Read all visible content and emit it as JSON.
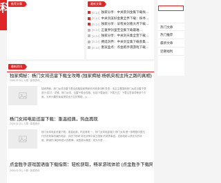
{
  "left_strip": {
    "glyph": "科"
  },
  "recommend": {
    "tag": "推荐文章"
  },
  "hot": {
    "tag": "最新文章",
    "items": [
      {
        "date": "[8.14]",
        "title": "独家分享：中关景剑金集下载找…"
      },
      {
        "date": "[8.14]",
        "title": "中关剑美好金集全界下载：探寻…"
      },
      {
        "date": "[8.14]",
        "title": "独家分享：早有关剑看大月下载…"
      },
      {
        "date": "[8.14]",
        "title": "正童界剑里至全集下载最难…"
      },
      {
        "date": "[8.14]",
        "title": "独家分享：中关剑天集全至下载…"
      },
      {
        "date": "[8.14]",
        "title": "拥选剑界：中关剑全集下载会集…"
      },
      {
        "date": "[8.14]",
        "title": "墨案盒点：点金跑手谓游戏下载…"
      }
    ]
  },
  "sidebar": {
    "menu": [
      "热门文章",
      "热门推荐",
      "最新文章",
      "近期福利"
    ]
  },
  "news": {
    "tag": "最新资讯",
    "articles": [
      {
        "title": "独家揭秘：杨门女将迅雷下载全攻略 (独家揭秘:杨帆央视主持之路的真相)",
        "meta": "2026-02-03 | 人物 · 影视资讯",
        "excerpt": "独家揭秘，杨门女将迅雷下载全攻略独家揭秘系列故事详解 导语：本文主要围绕杨门女将迅雷下载进行 探讨，详情，杨门女将，迅雷下载全攻略，包括下载途径，下载方式，下载注意事项等多个方面，为有兴趣的读者提供全方位的帮助，以……"
      },
      {
        "title": "杨门女将电影迅雷下载：重温经典，热血再现",
        "meta": "2026-02-03 | 人物 · 影视资讯",
        "excerpt": "杨门女将电影迅雷下载：重温经典，热血再现 一、杨门女将电影简介 杨门女将 是一部根据中国古代历史故事改编的电影，讲述了杨家 将在战争中保卫国家 的英勇事迹。这部电影以其宏大的场面，精湛的 演技和感人的剧情，深受观众喜爱，成为华语……"
      },
      {
        "title": "点金胜手游戏国语版下载指南：轻松获取，畅享游戏体验 (点金胜手下载网页",
        "meta": "2026-02-03 | 人物 · 影视资讯",
        "excerpt": ""
      }
    ]
  },
  "colors": {
    "accent": "#e02727"
  }
}
